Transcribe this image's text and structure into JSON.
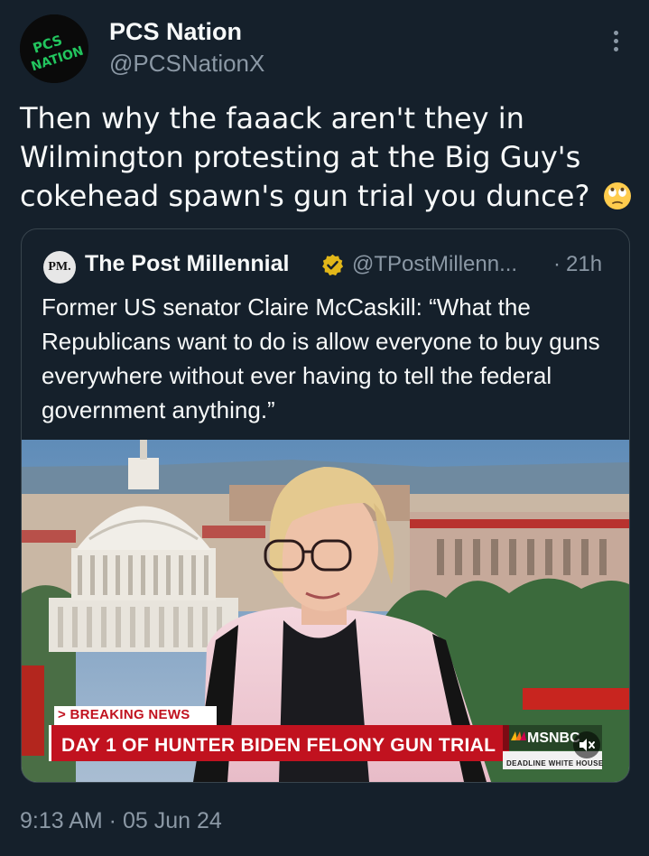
{
  "author": {
    "display_name": "PCS Nation",
    "handle": "@PCSNationX",
    "avatar_text_line1": "PCS",
    "avatar_text_line2": "NATION"
  },
  "tweet": {
    "text": "Then why the faaack aren't they in Wilmington protesting at the Big Guy's cokehead spawn's gun trial you dunce?",
    "emoji": "face-with-rolling-eyes",
    "timestamp": "9:13 AM · 05 Jun 24"
  },
  "quote": {
    "avatar_text": "PM.",
    "name": "The Post Millennial",
    "handle": "@TPostMillenn...",
    "separator": "·",
    "time": "21h",
    "text": "Former US senator Claire McCaskill: “What the Republicans want to do is allow everyone to buy guns everywhere without ever having to tell the federal government anything.”",
    "media": {
      "breaking_label": "> BREAKING NEWS",
      "headline": "DAY 1 OF HUNTER BIDEN FELONY GUN TRIAL",
      "network": "MSNBC",
      "show": "DEADLINE WHITE HOUSE"
    }
  },
  "colors": {
    "background": "#15202b",
    "text_primary": "#f7f9f9",
    "text_secondary": "#8b98a5",
    "verified_gold": "#e2b719",
    "border": "#38444d",
    "avatar_green": "#22c55e",
    "breaking_red": "#c1121f"
  }
}
